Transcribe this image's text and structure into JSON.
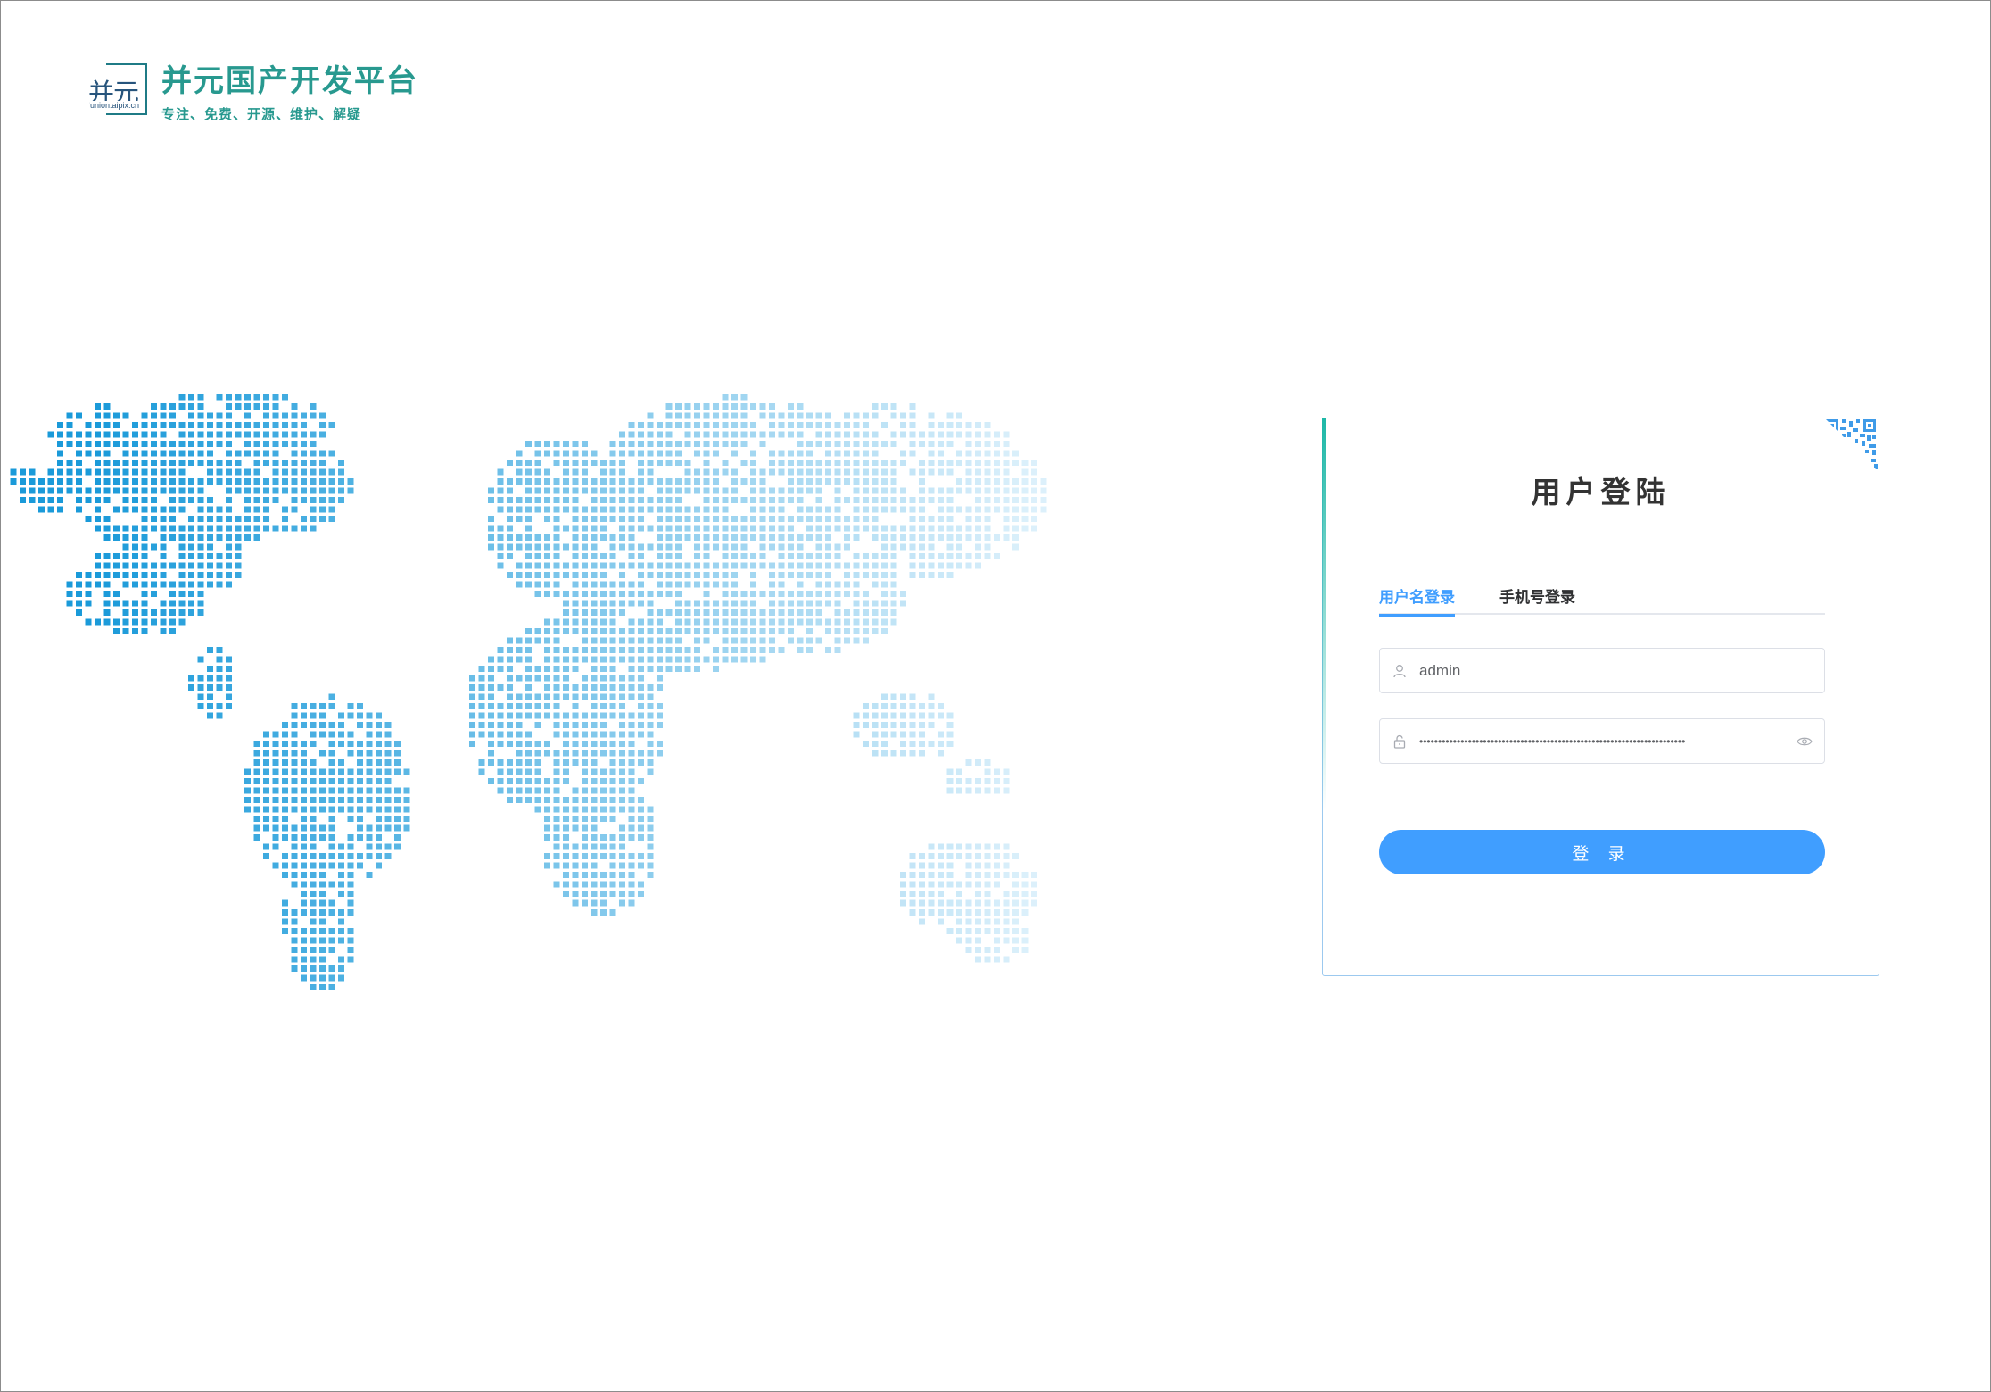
{
  "brand": {
    "mark_text": "并元",
    "mark_domain": "union.aipix.cn",
    "title": "并元国产开发平台",
    "slogan": "专注、免费、开源、维护、解疑"
  },
  "login": {
    "title": "用户登陆",
    "tabs": [
      {
        "label": "用户名登录",
        "active": true
      },
      {
        "label": "手机号登录",
        "active": false
      }
    ],
    "username": {
      "value": "admin",
      "icon": "user-icon"
    },
    "password": {
      "value": "•••••••••••••••••••••••••••••••••••••••••••••••••••••••••••••••••••••••",
      "icon": "lock-icon",
      "toggle_icon": "eye-icon"
    },
    "submit_label": "登 录",
    "corner_icon": "qr-code-icon"
  },
  "colors": {
    "brand": "#28998f",
    "primary": "#409eff",
    "map_dark": "#1a9ad9",
    "map_light": "#d9eef9"
  }
}
